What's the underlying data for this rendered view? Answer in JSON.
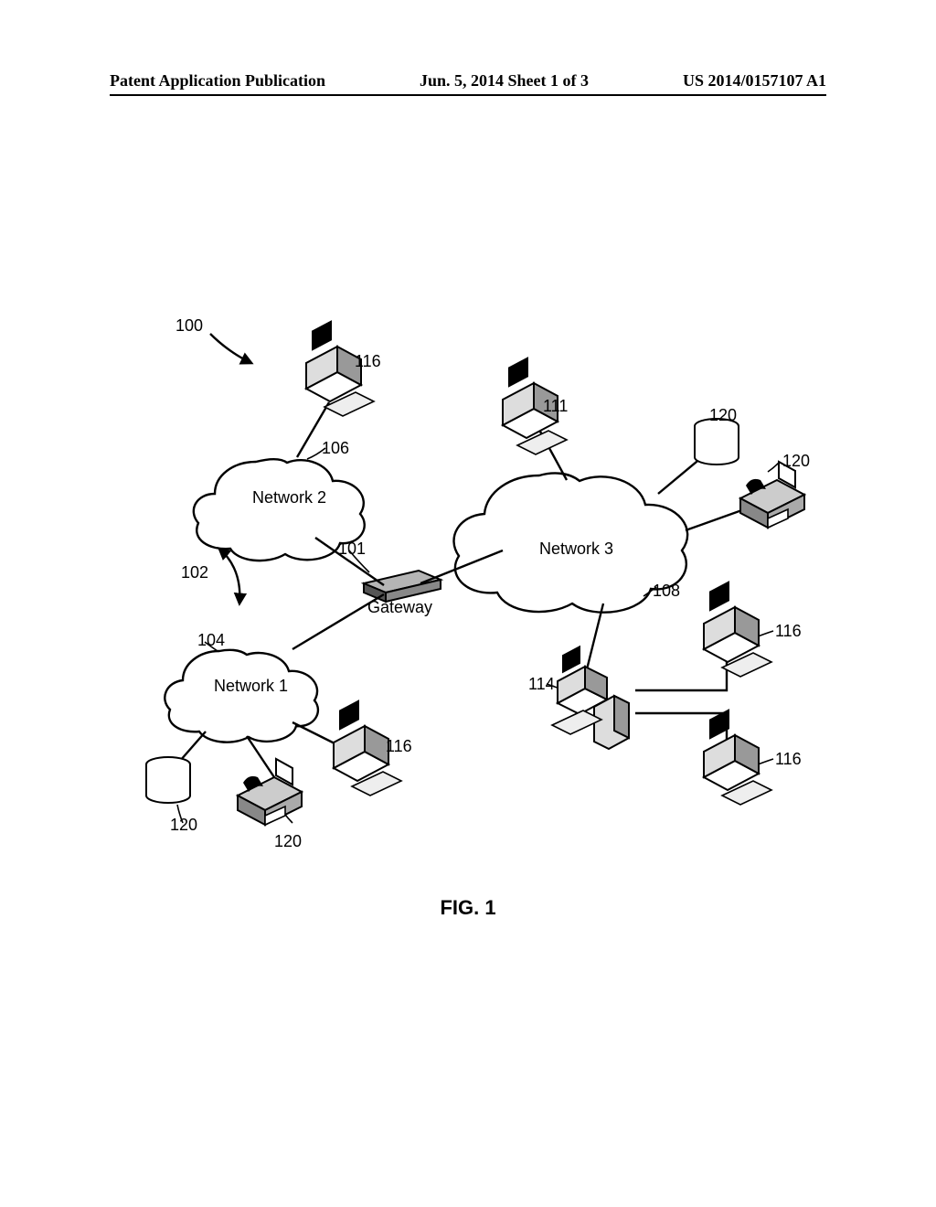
{
  "header": {
    "left": "Patent Application Publication",
    "center": "Jun. 5, 2014   Sheet 1 of 3",
    "right": "US 2014/0157107 A1"
  },
  "figure": {
    "caption": "FIG. 1",
    "system_ref": "100",
    "gateway": {
      "ref": "101",
      "label": "Gateway"
    },
    "bidir_ref": "102",
    "networks": [
      {
        "ref": "104",
        "label": "Network 1"
      },
      {
        "ref": "106",
        "label": "Network 2"
      },
      {
        "ref": "108",
        "label": "Network 3"
      }
    ],
    "nodes": {
      "workstation_n3": {
        "ref": "111"
      },
      "server_n3": {
        "ref": "114"
      },
      "terminal_refs": [
        "116",
        "116",
        "116",
        "116"
      ],
      "device_refs": [
        "120",
        "120",
        "120",
        "120"
      ]
    }
  }
}
